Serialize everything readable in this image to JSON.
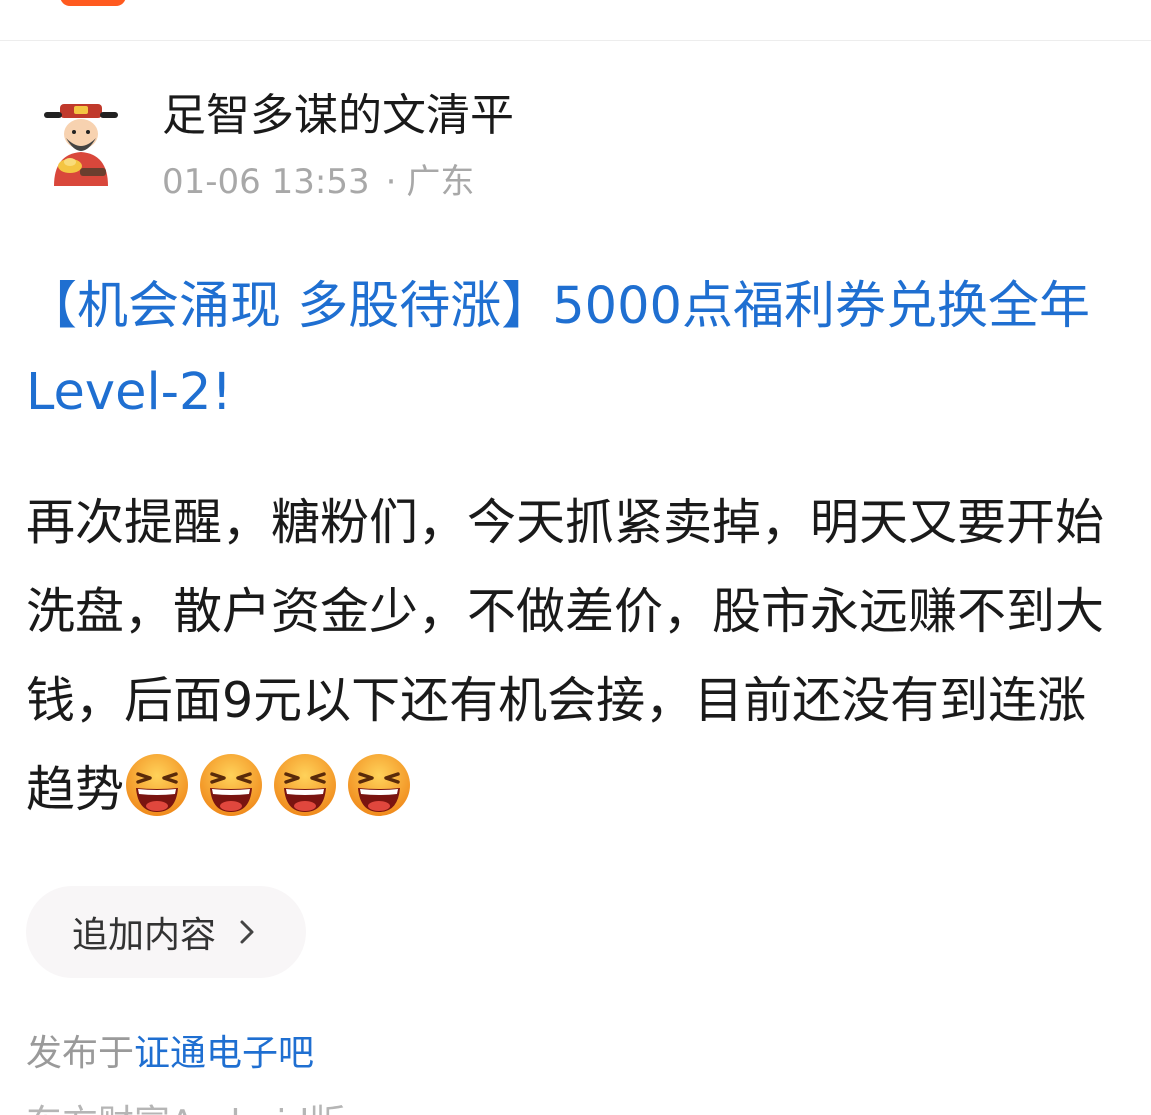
{
  "post": {
    "author": "足智多谋的文清平",
    "date": "01-06 13:53",
    "separator": "·",
    "location": "广东",
    "avatar_icon": "caishen-god-of-wealth-avatar",
    "title": "【机会涌现 多股待涨】5000点福利券兑换全年Level-2!",
    "body": "再次提醒，糖粉们，今天抓紧卖掉，明天又要开始洗盘，散户资金少，不做差价，股市永远赚不到大钱，后面9元以下还有机会接，目前还没有到连涨趋势",
    "emoji_icon": "laughing-tears-emoji",
    "emoji_count": 4,
    "append_label": "追加内容",
    "posted_prefix": "发布于",
    "posted_bar": "证通电子吧",
    "footer_partial": "东方财富Android版"
  },
  "colors": {
    "title_blue": "#1f6fd1",
    "link_blue": "#1f6fd1",
    "accent_orange": "#ff5a1f",
    "meta_gray": "#a8a8a8"
  }
}
